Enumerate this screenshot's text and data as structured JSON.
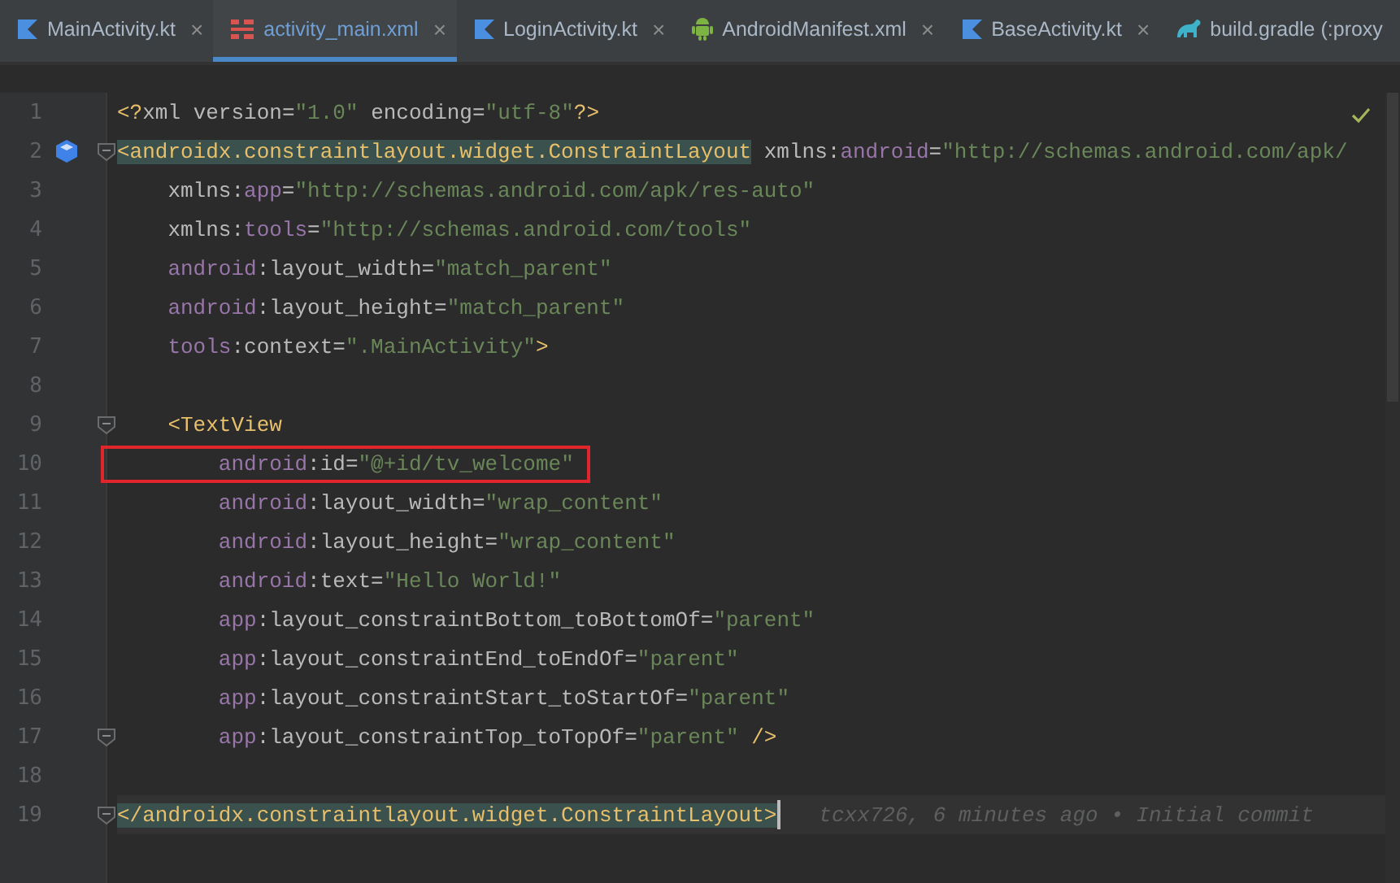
{
  "tabs": [
    {
      "kind": "kotlin",
      "label": "MainActivity.kt",
      "close": "×",
      "selected": false
    },
    {
      "kind": "layout",
      "label": "activity_main.xml",
      "close": "×",
      "selected": true
    },
    {
      "kind": "kotlin",
      "label": "LoginActivity.kt",
      "close": "×",
      "selected": false
    },
    {
      "kind": "android",
      "label": "AndroidManifest.xml",
      "close": "×",
      "selected": false
    },
    {
      "kind": "kotlin",
      "label": "BaseActivity.kt",
      "close": "×",
      "selected": false
    },
    {
      "kind": "gradle",
      "label": "build.gradle (:proxy",
      "selected": false
    }
  ],
  "editor": {
    "lines": [
      {
        "number": "1",
        "tokens": [
          {
            "kind": "tag",
            "text": "<?"
          },
          {
            "kind": "attr",
            "text": "xml version"
          },
          {
            "kind": "punct",
            "text": "="
          },
          {
            "kind": "string",
            "text": "\"1.0\" "
          },
          {
            "kind": "attr",
            "text": "encoding"
          },
          {
            "kind": "punct",
            "text": "="
          },
          {
            "kind": "string",
            "text": "\"utf-8\""
          },
          {
            "kind": "tag",
            "text": "?>"
          }
        ]
      },
      {
        "number": "2",
        "implementation_marker": true,
        "fold": true,
        "tokens": [
          {
            "kind": "tag-match",
            "text": "<androidx.constraintlayout.widget.ConstraintLayout"
          },
          {
            "kind": "attr",
            "text": " xmlns:"
          },
          {
            "kind": "ns",
            "text": "android"
          },
          {
            "kind": "punct",
            "text": "="
          },
          {
            "kind": "string",
            "text": "\"http://schemas.android.com/apk/"
          }
        ]
      },
      {
        "number": "3",
        "tokens": [
          {
            "kind": "attr",
            "text": "    xmlns:"
          },
          {
            "kind": "ns",
            "text": "app"
          },
          {
            "kind": "punct",
            "text": "="
          },
          {
            "kind": "string",
            "text": "\"http://schemas.android.com/apk/res-auto\""
          }
        ]
      },
      {
        "number": "4",
        "tokens": [
          {
            "kind": "attr",
            "text": "    xmlns:"
          },
          {
            "kind": "ns",
            "text": "tools"
          },
          {
            "kind": "punct",
            "text": "="
          },
          {
            "kind": "string",
            "text": "\"http://schemas.android.com/tools\""
          }
        ]
      },
      {
        "number": "5",
        "tokens": [
          {
            "kind": "ns",
            "text": "    android"
          },
          {
            "kind": "attr",
            "text": ":layout_width"
          },
          {
            "kind": "punct",
            "text": "="
          },
          {
            "kind": "string",
            "text": "\"match_parent\""
          }
        ]
      },
      {
        "number": "6",
        "tokens": [
          {
            "kind": "ns",
            "text": "    android"
          },
          {
            "kind": "attr",
            "text": ":layout_height"
          },
          {
            "kind": "punct",
            "text": "="
          },
          {
            "kind": "string",
            "text": "\"match_parent\""
          }
        ]
      },
      {
        "number": "7",
        "tokens": [
          {
            "kind": "ns",
            "text": "    tools"
          },
          {
            "kind": "attr",
            "text": ":context"
          },
          {
            "kind": "punct",
            "text": "="
          },
          {
            "kind": "string",
            "text": "\".MainActivity\""
          },
          {
            "kind": "tag",
            "text": ">"
          }
        ]
      },
      {
        "number": "8"
      },
      {
        "number": "9",
        "fold": true,
        "tokens": [
          {
            "kind": "tag",
            "text": "    <TextView"
          }
        ]
      },
      {
        "number": "10",
        "boxed": true,
        "tokens": [
          {
            "kind": "ns",
            "text": "        android"
          },
          {
            "kind": "attr",
            "text": ":id"
          },
          {
            "kind": "punct",
            "text": "="
          },
          {
            "kind": "string",
            "text": "\"@+id/tv_welcome\""
          }
        ]
      },
      {
        "number": "11",
        "tokens": [
          {
            "kind": "ns",
            "text": "        android"
          },
          {
            "kind": "attr",
            "text": ":layout_width"
          },
          {
            "kind": "punct",
            "text": "="
          },
          {
            "kind": "string",
            "text": "\"wrap_content\""
          }
        ]
      },
      {
        "number": "12",
        "tokens": [
          {
            "kind": "ns",
            "text": "        android"
          },
          {
            "kind": "attr",
            "text": ":layout_height"
          },
          {
            "kind": "punct",
            "text": "="
          },
          {
            "kind": "string",
            "text": "\"wrap_content\""
          }
        ]
      },
      {
        "number": "13",
        "tokens": [
          {
            "kind": "ns",
            "text": "        android"
          },
          {
            "kind": "attr",
            "text": ":text"
          },
          {
            "kind": "punct",
            "text": "="
          },
          {
            "kind": "string",
            "text": "\"Hello World!\""
          }
        ]
      },
      {
        "number": "14",
        "tokens": [
          {
            "kind": "ns",
            "text": "        app"
          },
          {
            "kind": "attr",
            "text": ":layout_constraintBottom_toBottomOf"
          },
          {
            "kind": "punct",
            "text": "="
          },
          {
            "kind": "string",
            "text": "\"parent\""
          }
        ]
      },
      {
        "number": "15",
        "tokens": [
          {
            "kind": "ns",
            "text": "        app"
          },
          {
            "kind": "attr",
            "text": ":layout_constraintEnd_toEndOf"
          },
          {
            "kind": "punct",
            "text": "="
          },
          {
            "kind": "string",
            "text": "\"parent\""
          }
        ]
      },
      {
        "number": "16",
        "tokens": [
          {
            "kind": "ns",
            "text": "        app"
          },
          {
            "kind": "attr",
            "text": ":layout_constraintStart_toStartOf"
          },
          {
            "kind": "punct",
            "text": "="
          },
          {
            "kind": "string",
            "text": "\"parent\""
          }
        ]
      },
      {
        "number": "17",
        "fold": true,
        "tokens": [
          {
            "kind": "ns",
            "text": "        app"
          },
          {
            "kind": "attr",
            "text": ":layout_constraintTop_toTopOf"
          },
          {
            "kind": "punct",
            "text": "="
          },
          {
            "kind": "string",
            "text": "\"parent\" "
          },
          {
            "kind": "tag",
            "text": "/>"
          }
        ]
      },
      {
        "number": "18"
      },
      {
        "number": "19",
        "fold": true,
        "current": true,
        "tokens": [
          {
            "kind": "tag-match",
            "text": "</androidx.constraintlayout.widget.ConstraintLayout>"
          }
        ],
        "blame": "tcxx726, 6 minutes ago • Initial commit"
      }
    ]
  }
}
